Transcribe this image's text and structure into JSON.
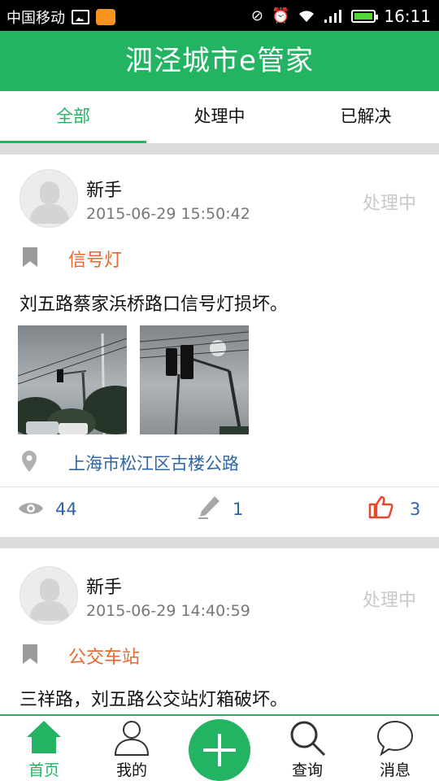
{
  "status_bar": {
    "carrier": "中国移动",
    "time": "16:11"
  },
  "header": {
    "title": "泗泾城市e管家"
  },
  "tabs": [
    {
      "label": "全部",
      "active": true
    },
    {
      "label": "处理中",
      "active": false
    },
    {
      "label": "已解决",
      "active": false
    }
  ],
  "posts": [
    {
      "user": "新手",
      "time": "2015-06-29 15:50:42",
      "status": "处理中",
      "category": "信号灯",
      "description": "刘五路蔡家浜桥路口信号灯损坏。",
      "location": "上海市松江区古楼公路",
      "views": "44",
      "comments": "1",
      "likes": "3",
      "photos": [
        "traffic-light-photo-1",
        "traffic-light-photo-2"
      ]
    },
    {
      "user": "新手",
      "time": "2015-06-29 14:40:59",
      "status": "处理中",
      "category": "公交车站",
      "description": "三祥路，刘五路公交站灯箱破坏。"
    }
  ],
  "bottom_nav": {
    "items": [
      {
        "label": "首页",
        "icon": "home-icon",
        "active": true
      },
      {
        "label": "我的",
        "icon": "user-icon",
        "active": false
      },
      {
        "label": "",
        "icon": "plus-icon",
        "active": false
      },
      {
        "label": "查询",
        "icon": "search-icon",
        "active": false
      },
      {
        "label": "消息",
        "icon": "message-icon",
        "active": false
      }
    ]
  },
  "colors": {
    "brand": "#22b462",
    "category": "#e8672f",
    "link": "#2e66a8",
    "like": "#e8482f",
    "status_muted": "#c9c9c9"
  }
}
